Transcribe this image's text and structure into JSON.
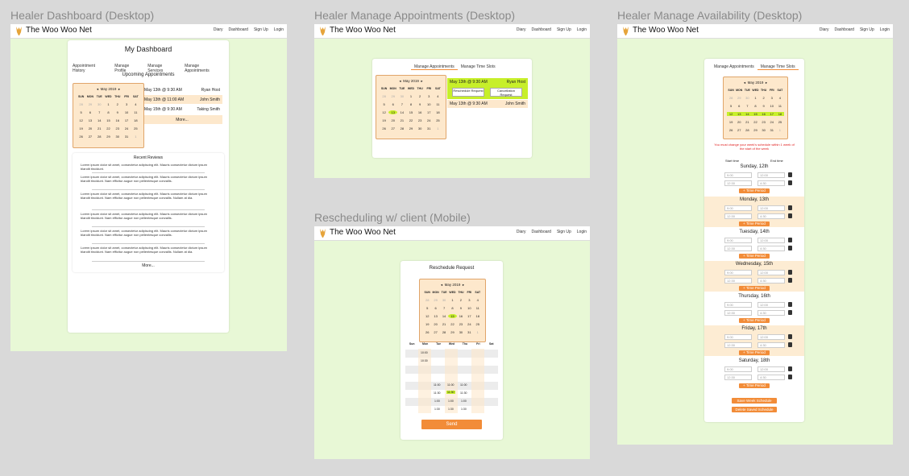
{
  "app": {
    "brand": "The Woo Woo Net",
    "nav_links": [
      "Diary",
      "Dashboard",
      "Sign Up",
      "Login"
    ]
  },
  "frames": {
    "dashboard": {
      "title": "Healer Dashboard (Desktop)"
    },
    "appointments": {
      "title": "Healer Manage Appointments (Desktop)"
    },
    "availability": {
      "title": "Healer Manage Availability (Desktop)"
    },
    "reschedule": {
      "title": "Rescheduling w/ client (Mobile)"
    }
  },
  "dashboard": {
    "heading": "My Dashboard",
    "tabs": [
      "Appointment History",
      "Manage Profile",
      "Manage Services",
      "Manage Appointments"
    ],
    "upcoming_title": "Upcoming Appointments",
    "appointments": [
      {
        "when": "May 13th @ 9:30 AM",
        "who": "Ryan Host"
      },
      {
        "when": "May 13th @ 11:00 AM",
        "who": "John Smith"
      },
      {
        "when": "May 15th @ 9:30 AM",
        "who": "Taking Smith"
      }
    ],
    "more": "More...",
    "reviews_title": "Recent Reviews",
    "reviews": [
      "Lorem ipsum dolor sit amet, consectetur adipiscing elit. Mauris consectetur dictum ipsum blandit tincidunt.",
      "Lorem ipsum dolor sit amet, consectetur adipiscing elit. Mauris consectetur dictum ipsum blandit tincidunt. Nam efficitur augue non pellentesque convallis.",
      "Lorem ipsum dolor sit amet, consectetur adipiscing elit. Mauris consectetur dictum ipsum blandit tincidunt. Nam efficitur augue non pellentesque convallis. Nullam at dia.",
      "Lorem ipsum dolor sit amet, consectetur adipiscing elit. Mauris consectetur dictum ipsum blandit tincidunt. Nam efficitur augue non pellentesque convallis.",
      "Lorem ipsum dolor sit amet, consectetur adipiscing elit. Mauris consectetur dictum ipsum blandit tincidunt. Nam efficitur augue non pellentesque convallis.",
      "Lorem ipsum dolor sit amet, consectetur adipiscing elit. Mauris consectetur dictum ipsum blandit tincidunt. Nam efficitur augue non pellentesque convallis. Nullam at dia."
    ],
    "reviews_more": "More..."
  },
  "calendar": {
    "month": "May 2019",
    "prev": "◂",
    "next": "▸",
    "dow": [
      "SUN",
      "MON",
      "TUE",
      "WED",
      "THU",
      "FRI",
      "SAT"
    ],
    "weeks": [
      [
        "28",
        "29",
        "30",
        "1",
        "2",
        "3",
        "4"
      ],
      [
        "5",
        "6",
        "7",
        "8",
        "9",
        "10",
        "11"
      ],
      [
        "12",
        "13",
        "14",
        "15",
        "16",
        "17",
        "18"
      ],
      [
        "19",
        "20",
        "21",
        "22",
        "23",
        "24",
        "25"
      ],
      [
        "26",
        "27",
        "28",
        "29",
        "30",
        "31",
        "1"
      ]
    ]
  },
  "appointments_page": {
    "tabs": [
      "Manage Appointments",
      "Manage Time Slots"
    ],
    "rows": [
      {
        "when": "May 13th @ 9:30 AM",
        "who": "Ryan Host"
      },
      {
        "when": "May 13th @ 9:30 AM",
        "who": "John Smith"
      }
    ],
    "reschedule_btn": "Reschedule Request",
    "cancel_btn": "Cancellation Request"
  },
  "availability_page": {
    "tabs": [
      "Manage Appointments",
      "Manage Time Slots"
    ],
    "warning": "You must change your week's schedule within 1 week of the start of the week",
    "start_label": "Start time",
    "end_label": "End time",
    "days": [
      "Sunday, 12th",
      "Monday, 13th",
      "Tuesday, 14th",
      "Wednesday, 15th",
      "Thursday, 16th",
      "Friday, 17th",
      "Saturday, 18th"
    ],
    "slot_a": [
      "9:00",
      "12:00"
    ],
    "slot_b": [
      "12:30",
      "4:30"
    ],
    "add_period": "+ Time Period",
    "save_btn": "Save Week Schedule",
    "delete_btn": "Delete Saved Schedule"
  },
  "reschedule_page": {
    "title": "Reschedule Request",
    "table_head": [
      "Sun",
      "Mon",
      "Tue",
      "Wed",
      "Thu",
      "Fri",
      "Sat"
    ],
    "times": {
      "mon_a": "10:00",
      "mon_b": "10:30",
      "r1": "11:00",
      "r2": "11:30",
      "r3": "1:00",
      "r4": "1:30"
    },
    "send": "Send"
  }
}
